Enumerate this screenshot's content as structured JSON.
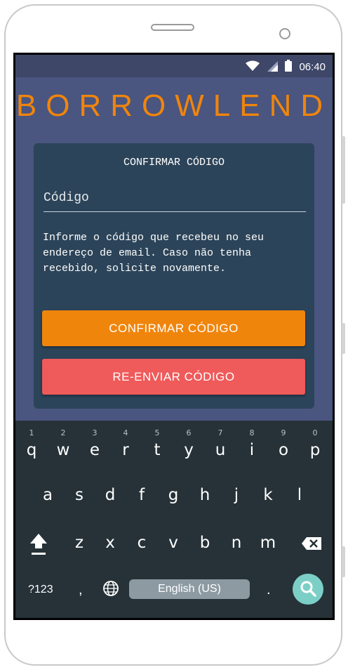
{
  "status_bar": {
    "time": "06:40",
    "icons": [
      "wifi-icon",
      "signal-icon",
      "battery-icon"
    ]
  },
  "app": {
    "logo": "BORROWLEND",
    "accent_color": "#f0850c",
    "danger_color": "#ef5a5a",
    "background_color": "#4a5580",
    "card_color": "#2c4459"
  },
  "card": {
    "title": "CONFIRMAR CÓDIGO",
    "code_placeholder": "Código",
    "code_value": "",
    "info_text": "Informe o código que recebeu no seu endereço de email. Caso não tenha recebido, solicite novamente.",
    "confirm_button": "CONFIRMAR CÓDIGO",
    "resend_button": "RE-ENVIAR CÓDIGO"
  },
  "keyboard": {
    "row1": [
      {
        "key": "q",
        "hint": "1"
      },
      {
        "key": "w",
        "hint": "2"
      },
      {
        "key": "e",
        "hint": "3"
      },
      {
        "key": "r",
        "hint": "4"
      },
      {
        "key": "t",
        "hint": "5"
      },
      {
        "key": "y",
        "hint": "6"
      },
      {
        "key": "u",
        "hint": "7"
      },
      {
        "key": "i",
        "hint": "8"
      },
      {
        "key": "o",
        "hint": "9"
      },
      {
        "key": "p",
        "hint": "0"
      }
    ],
    "row2": [
      "a",
      "s",
      "d",
      "f",
      "g",
      "h",
      "j",
      "k",
      "l"
    ],
    "row3": [
      "z",
      "x",
      "c",
      "v",
      "b",
      "n",
      "m"
    ],
    "symbols_key": "?123",
    "comma_key": ",",
    "space_label": "English (US)",
    "period_key": "."
  }
}
